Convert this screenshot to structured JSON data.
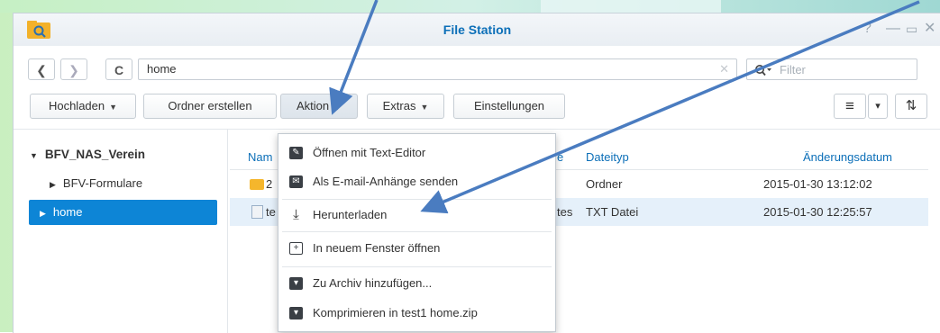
{
  "window": {
    "title": "File Station",
    "controls": [
      "?",
      "—",
      "▭",
      "✕"
    ]
  },
  "nav": {
    "back": "❮",
    "forward": "❯",
    "refresh": "C",
    "path": "home",
    "path_clear": "✕",
    "filter_placeholder": "Filter",
    "filter_icon": "search-icon"
  },
  "toolbar": {
    "upload": "Hochladen",
    "create_folder": "Ordner erstellen",
    "action": "Aktion",
    "extras": "Extras",
    "settings": "Einstellungen",
    "caret": "▼",
    "view_list": "≡",
    "view_caret": "▾",
    "sort": "⇅"
  },
  "sidebar": {
    "root": "BFV_NAS_Verein",
    "items": [
      {
        "label": "BFV-Formulare",
        "selected": false
      },
      {
        "label": "home",
        "selected": true
      }
    ],
    "expanded_arrow": "▼",
    "collapsed_arrow": "▶"
  },
  "table": {
    "columns": [
      "Nam",
      "e",
      "Dateityp",
      "Änderungsdatum"
    ],
    "rows": [
      {
        "name": "2",
        "size": "",
        "type": "Ordner",
        "date": "2015-01-30 13:12:02",
        "icon": "folder-icon"
      },
      {
        "name": "te",
        "size": "tes",
        "type": "TXT Datei",
        "date": "2015-01-30 12:25:57",
        "icon": "file-icon",
        "selected": true
      }
    ]
  },
  "context_menu": {
    "items": [
      {
        "label": "Öffnen mit Text-Editor",
        "icon": "edit-icon"
      },
      {
        "label": "Als E-mail-Anhänge senden",
        "icon": "mail-icon"
      },
      {
        "label": "Herunterladen",
        "icon": "download-icon"
      },
      {
        "label": "In neuem Fenster öffnen",
        "icon": "new-window-icon"
      },
      {
        "label": "Zu Archiv hinzufügen...",
        "icon": "archive-icon"
      },
      {
        "label": "Komprimieren in test1 home.zip",
        "icon": "compress-icon"
      }
    ]
  },
  "colors": {
    "accent": "#0c6fb8",
    "selected_bg": "#0d85d6",
    "row_selected_bg": "#e5f0fa",
    "annotation_arrow": "#4a7cc0"
  }
}
